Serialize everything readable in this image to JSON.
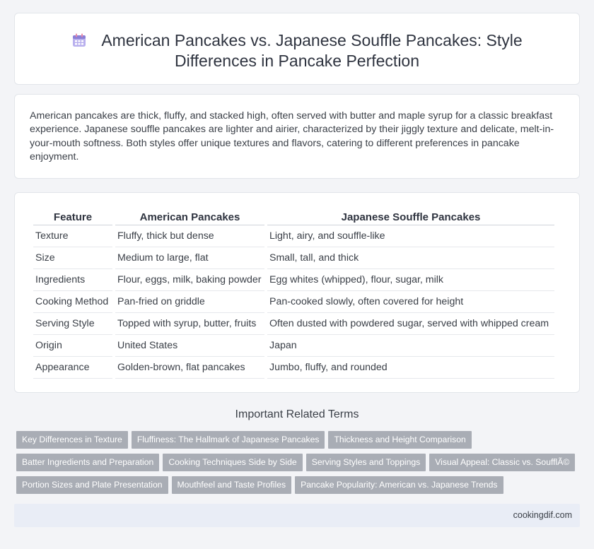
{
  "header": {
    "icon": "calendar-icon",
    "title": "American Pancakes vs. Japanese Souffle Pancakes: Style Differences in Pancake Perfection"
  },
  "intro": "American pancakes are thick, fluffy, and stacked high, often served with butter and maple syrup for a classic breakfast experience. Japanese souffle pancakes are lighter and airier, characterized by their jiggly texture and delicate, melt-in-your-mouth softness. Both styles offer unique textures and flavors, catering to different preferences in pancake enjoyment.",
  "table": {
    "headers": [
      "Feature",
      "American Pancakes",
      "Japanese Souffle Pancakes"
    ],
    "rows": [
      [
        "Texture",
        "Fluffy, thick but dense",
        "Light, airy, and souffle-like"
      ],
      [
        "Size",
        "Medium to large, flat",
        "Small, tall, and thick"
      ],
      [
        "Ingredients",
        "Flour, eggs, milk, baking powder",
        "Egg whites (whipped), flour, sugar, milk"
      ],
      [
        "Cooking Method",
        "Pan-fried on griddle",
        "Pan-cooked slowly, often covered for height"
      ],
      [
        "Serving Style",
        "Topped with syrup, butter, fruits",
        "Often dusted with powdered sugar, served with whipped cream"
      ],
      [
        "Origin",
        "United States",
        "Japan"
      ],
      [
        "Appearance",
        "Golden-brown, flat pancakes",
        "Jumbo, fluffy, and rounded"
      ]
    ]
  },
  "related": {
    "title": "Important Related Terms",
    "tag_rows": [
      [
        "Key Differences in Texture",
        "Fluffiness: The Hallmark of Japanese Pancakes",
        "Thickness and Height Comparison"
      ],
      [
        "Batter Ingredients and Preparation",
        "Cooking Techniques Side by Side",
        "Serving Styles and Toppings",
        "Visual Appeal: Classic vs. SoufflÃ©"
      ],
      [
        "Portion Sizes and Plate Presentation",
        "Mouthfeel and Taste Profiles",
        "Pancake Popularity: American vs. Japanese Trends"
      ]
    ]
  },
  "footer": {
    "site": "cookingdif.com"
  },
  "colors": {
    "page_bg": "#f3f4f7",
    "tag_bg": "#a9adb5",
    "footer_bg": "#e9edf6",
    "icon_purple": "#8b7fd6",
    "icon_pink": "#e88aa8"
  }
}
